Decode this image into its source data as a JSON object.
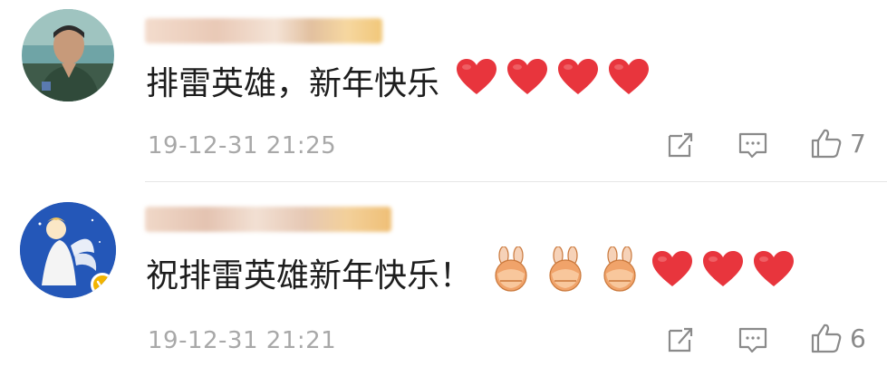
{
  "comments": [
    {
      "text": "排雷英雄，新年快乐",
      "emojis": [
        "heart",
        "heart",
        "heart",
        "heart"
      ],
      "timestamp": "19-12-31 21:25",
      "likes": "7",
      "verified": false
    },
    {
      "text": "祝排雷英雄新年快乐！",
      "emojis": [
        "bunny",
        "bunny",
        "bunny",
        "heart",
        "heart",
        "heart"
      ],
      "timestamp": "19-12-31 21:21",
      "likes": "6",
      "verified": true
    }
  ],
  "icons": {
    "share": "share-icon",
    "reply": "comment-icon",
    "like": "thumbs-up-icon"
  },
  "colors": {
    "text": "#1d1d1d",
    "meta": "#a8a8a8",
    "icon": "#8a8a8a",
    "heart": "#e8353d",
    "verified_badge": "#f2b400"
  }
}
